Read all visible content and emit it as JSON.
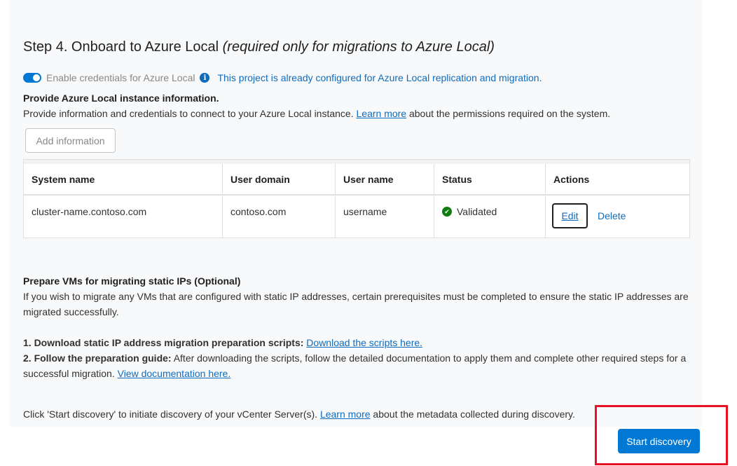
{
  "step": {
    "title": "Step 4. Onboard to Azure Local ",
    "title_italic": "(required only for migrations to Azure Local)"
  },
  "credentials_toggle": {
    "label": "Enable credentials for Azure Local",
    "on": true,
    "info_message": "This project is already configured for Azure Local replication and migration."
  },
  "instance_info": {
    "heading": "Provide Azure Local instance information.",
    "text_before": "Provide information and credentials to connect to your Azure Local instance. ",
    "link": "Learn more",
    "text_after": " about the permissions required on the system.",
    "add_button": "Add information"
  },
  "table": {
    "headers": [
      "System name",
      "User domain",
      "User name",
      "Status",
      "Actions"
    ],
    "rows": [
      {
        "system_name": "cluster-name.contoso.com",
        "user_domain": "contoso.com",
        "user_name": "username",
        "status": "Validated",
        "edit": "Edit",
        "delete": "Delete"
      }
    ]
  },
  "static_ips": {
    "heading": "Prepare VMs for migrating static IPs (Optional)",
    "description": "If you wish to migrate any VMs that are configured with static IP addresses, certain prerequisites must be completed to ensure the static IP addresses are migrated successfully.",
    "step1_label": "1. Download static IP address migration preparation scripts:",
    "step1_link": "Download the scripts here.",
    "step2_label": "2. Follow the preparation guide:",
    "step2_text": " After downloading the scripts, follow the detailed documentation to apply them and complete other required steps for a successful migration. ",
    "step2_link": "View documentation here."
  },
  "discovery": {
    "text_before": "Click 'Start discovery' to initiate discovery of your vCenter Server(s). ",
    "link": "Learn more",
    "text_after": " about the metadata collected during discovery.",
    "button": "Start discovery"
  },
  "colors": {
    "accent": "#0078d4",
    "link": "#0f6cbd",
    "success": "#107c10",
    "highlight": "#e81123"
  }
}
